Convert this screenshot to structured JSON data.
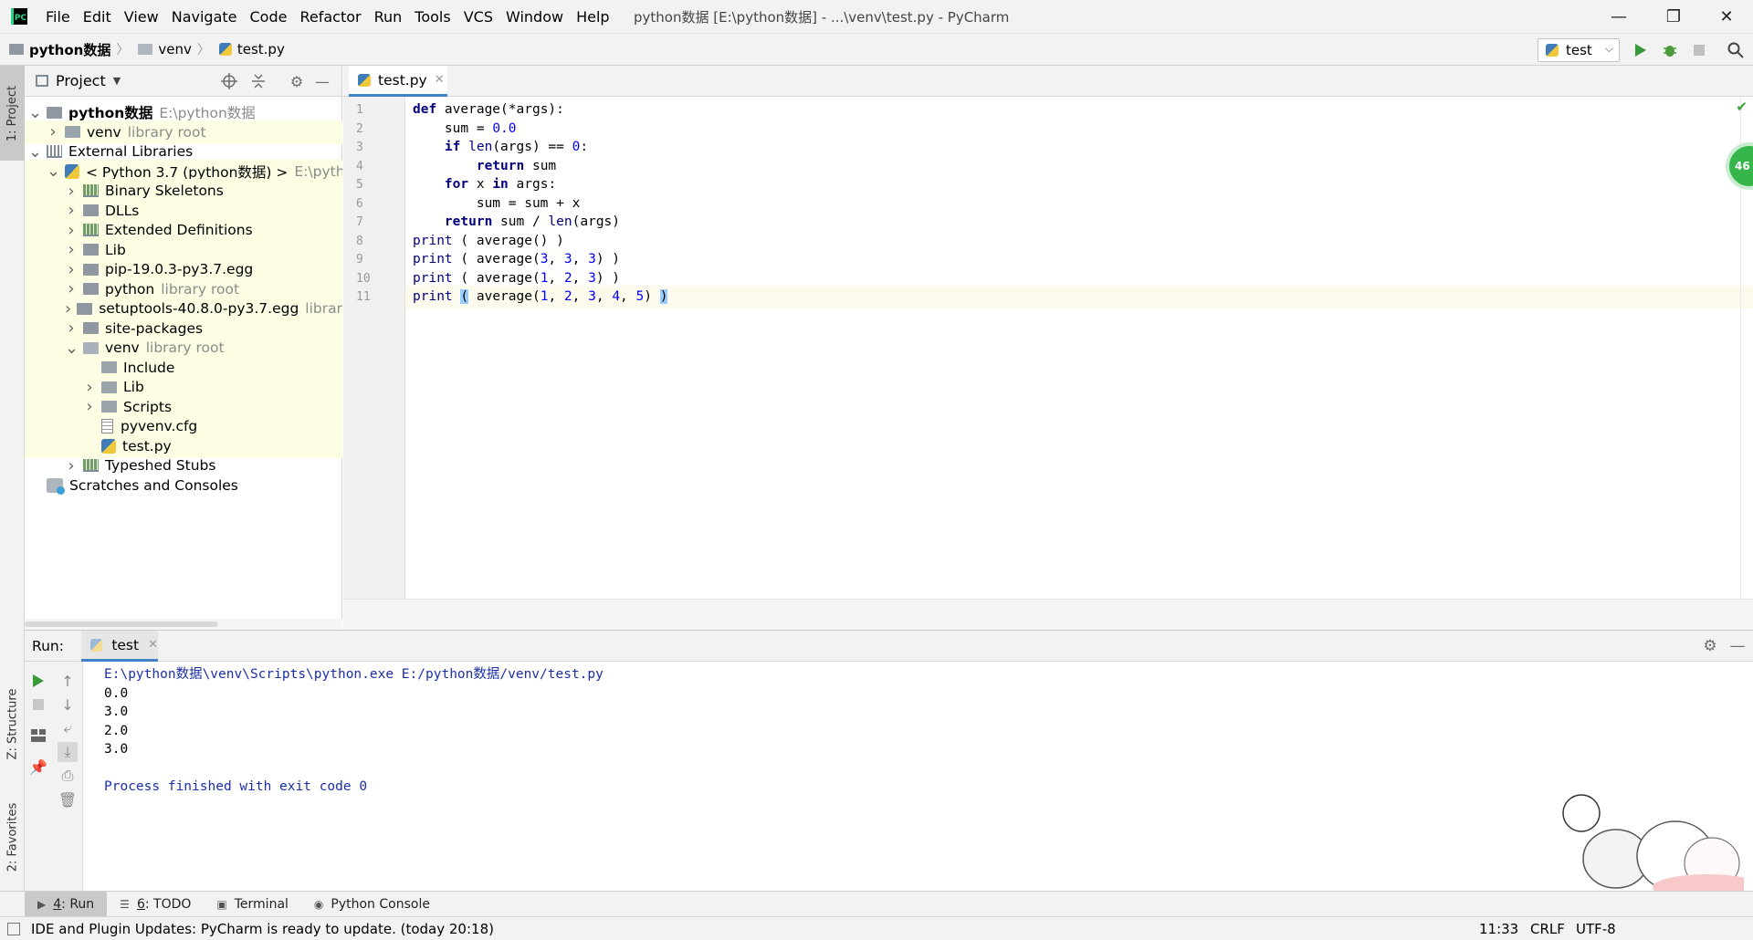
{
  "menu": [
    "File",
    "Edit",
    "View",
    "Navigate",
    "Code",
    "Refactor",
    "Run",
    "Tools",
    "VCS",
    "Window",
    "Help"
  ],
  "window_title": "python数据 [E:\\python数据] - ...\\venv\\test.py - PyCharm",
  "window_controls": {
    "minimize": "—",
    "restore": "❐",
    "close": "✕"
  },
  "breadcrumb": [
    "python数据",
    "venv",
    "test.py"
  ],
  "run_config": "test",
  "project_panel": {
    "title": "Project",
    "tree": [
      {
        "label": "python数据",
        "hint": "E:\\python数据",
        "arrow": "v",
        "icon": "folder",
        "indent": 0,
        "hl": false,
        "bold": true
      },
      {
        "label": "venv",
        "hint": "library root",
        "arrow": ">",
        "icon": "lib-folder",
        "indent": 1,
        "hl": true
      },
      {
        "label": "External Libraries",
        "hint": "",
        "arrow": "v",
        "icon": "libs",
        "indent": 0,
        "hl": false
      },
      {
        "label": "< Python 3.7 (python数据) >",
        "hint": "E:\\python",
        "arrow": "v",
        "icon": "python",
        "indent": 1,
        "hl": true
      },
      {
        "label": "Binary Skeletons",
        "hint": "",
        "arrow": ">",
        "icon": "libs-py",
        "indent": 2,
        "hl": true
      },
      {
        "label": "DLLs",
        "hint": "",
        "arrow": ">",
        "icon": "folder",
        "indent": 2,
        "hl": true
      },
      {
        "label": "Extended Definitions",
        "hint": "",
        "arrow": ">",
        "icon": "libs-py",
        "indent": 2,
        "hl": true
      },
      {
        "label": "Lib",
        "hint": "",
        "arrow": ">",
        "icon": "folder",
        "indent": 2,
        "hl": true
      },
      {
        "label": "pip-19.0.3-py3.7.egg",
        "hint": "",
        "arrow": ">",
        "icon": "folder",
        "indent": 2,
        "hl": true
      },
      {
        "label": "python",
        "hint": "library root",
        "arrow": ">",
        "icon": "folder",
        "indent": 2,
        "hl": true
      },
      {
        "label": "setuptools-40.8.0-py3.7.egg",
        "hint": "librar",
        "arrow": ">",
        "icon": "folder",
        "indent": 2,
        "hl": true
      },
      {
        "label": "site-packages",
        "hint": "",
        "arrow": ">",
        "icon": "folder",
        "indent": 2,
        "hl": true
      },
      {
        "label": "venv",
        "hint": "library root",
        "arrow": "v",
        "icon": "open-folder",
        "indent": 2,
        "hl": true
      },
      {
        "label": "Include",
        "hint": "",
        "arrow": "",
        "icon": "lib-folder",
        "indent": 3,
        "hl": true
      },
      {
        "label": "Lib",
        "hint": "",
        "arrow": ">",
        "icon": "lib-folder",
        "indent": 3,
        "hl": true
      },
      {
        "label": "Scripts",
        "hint": "",
        "arrow": ">",
        "icon": "lib-folder",
        "indent": 3,
        "hl": true
      },
      {
        "label": "pyvenv.cfg",
        "hint": "",
        "arrow": "",
        "icon": "file",
        "indent": 3,
        "hl": true
      },
      {
        "label": "test.py",
        "hint": "",
        "arrow": "",
        "icon": "python",
        "indent": 3,
        "hl": true
      },
      {
        "label": "Typeshed Stubs",
        "hint": "",
        "arrow": ">",
        "icon": "libs-py",
        "indent": 2,
        "hl": false
      },
      {
        "label": "Scratches and Consoles",
        "hint": "",
        "arrow": "",
        "icon": "scratch",
        "indent": 0,
        "hl": false
      }
    ]
  },
  "editor": {
    "tab": "test.py",
    "lines": [
      [
        [
          "kw",
          "def"
        ],
        [
          "t",
          " average(*args):"
        ]
      ],
      [
        [
          "t",
          "    sum = "
        ],
        [
          "num",
          "0.0"
        ]
      ],
      [
        [
          "t",
          "    "
        ],
        [
          "kw",
          "if"
        ],
        [
          "t",
          " "
        ],
        [
          "bi",
          "len"
        ],
        [
          "t",
          "(args) == "
        ],
        [
          "num",
          "0"
        ],
        [
          "t",
          ":"
        ]
      ],
      [
        [
          "t",
          "        "
        ],
        [
          "kw",
          "return"
        ],
        [
          "t",
          " sum"
        ]
      ],
      [
        [
          "t",
          "    "
        ],
        [
          "kw",
          "for"
        ],
        [
          "t",
          " x "
        ],
        [
          "kw",
          "in"
        ],
        [
          "t",
          " args:"
        ]
      ],
      [
        [
          "t",
          "        sum = sum + x"
        ]
      ],
      [
        [
          "t",
          "    "
        ],
        [
          "kw",
          "return"
        ],
        [
          "t",
          " sum / "
        ],
        [
          "bi",
          "len"
        ],
        [
          "t",
          "(args)"
        ]
      ],
      [
        [
          "bi",
          "print"
        ],
        [
          "t",
          " ( average() )"
        ]
      ],
      [
        [
          "bi",
          "print"
        ],
        [
          "t",
          " ( average("
        ],
        [
          "num",
          "3"
        ],
        [
          "t",
          ", "
        ],
        [
          "num",
          "3"
        ],
        [
          "t",
          ", "
        ],
        [
          "num",
          "3"
        ],
        [
          "t",
          ") )"
        ]
      ],
      [
        [
          "bi",
          "print"
        ],
        [
          "t",
          " ( average("
        ],
        [
          "num",
          "1"
        ],
        [
          "t",
          ", "
        ],
        [
          "num",
          "2"
        ],
        [
          "t",
          ", "
        ],
        [
          "num",
          "3"
        ],
        [
          "t",
          ") )"
        ]
      ],
      [
        [
          "bi",
          "print"
        ],
        [
          "t",
          " "
        ],
        [
          "br",
          "("
        ],
        [
          "t",
          " average("
        ],
        [
          "num",
          "1"
        ],
        [
          "t",
          ", "
        ],
        [
          "num",
          "2"
        ],
        [
          "t",
          ", "
        ],
        [
          "num",
          "3"
        ],
        [
          "t",
          ", "
        ],
        [
          "num",
          "4"
        ],
        [
          "t",
          ", "
        ],
        [
          "num",
          "5"
        ],
        [
          "t",
          ") "
        ],
        [
          "br",
          ")"
        ]
      ]
    ],
    "current_line": 11,
    "badge": "46"
  },
  "run_panel": {
    "label": "Run:",
    "tab": "test",
    "output": [
      {
        "text": "E:\\python数据\\venv\\Scripts\\python.exe E:/python数据/venv/test.py",
        "blue": true
      },
      {
        "text": "0.0",
        "blue": false
      },
      {
        "text": "3.0",
        "blue": false
      },
      {
        "text": "2.0",
        "blue": false
      },
      {
        "text": "3.0",
        "blue": false
      },
      {
        "text": "",
        "blue": false
      },
      {
        "text": "Process finished with exit code 0",
        "blue": true
      }
    ]
  },
  "side_tabs": {
    "project": "1: Project",
    "structure": "Z: Structure",
    "favorites": "2: Favorites"
  },
  "bottom_tools": [
    {
      "key": "4",
      "label": ": Run",
      "icon": "▶"
    },
    {
      "key": "6",
      "label": ": TODO",
      "icon": "☰"
    },
    {
      "key": "",
      "label": "Terminal",
      "icon": "▣"
    },
    {
      "key": "",
      "label": "Python Console",
      "icon": "◉"
    }
  ],
  "status": {
    "message": "IDE and Plugin Updates: PyCharm is ready to update. (today 20:18)",
    "position": "11:33",
    "line_sep": "CRLF",
    "encoding": "UTF-8"
  },
  "colors": {
    "accent": "#4083c9",
    "keyword": "#000080",
    "number": "#0000ff",
    "highlight": "#fdfde3"
  }
}
